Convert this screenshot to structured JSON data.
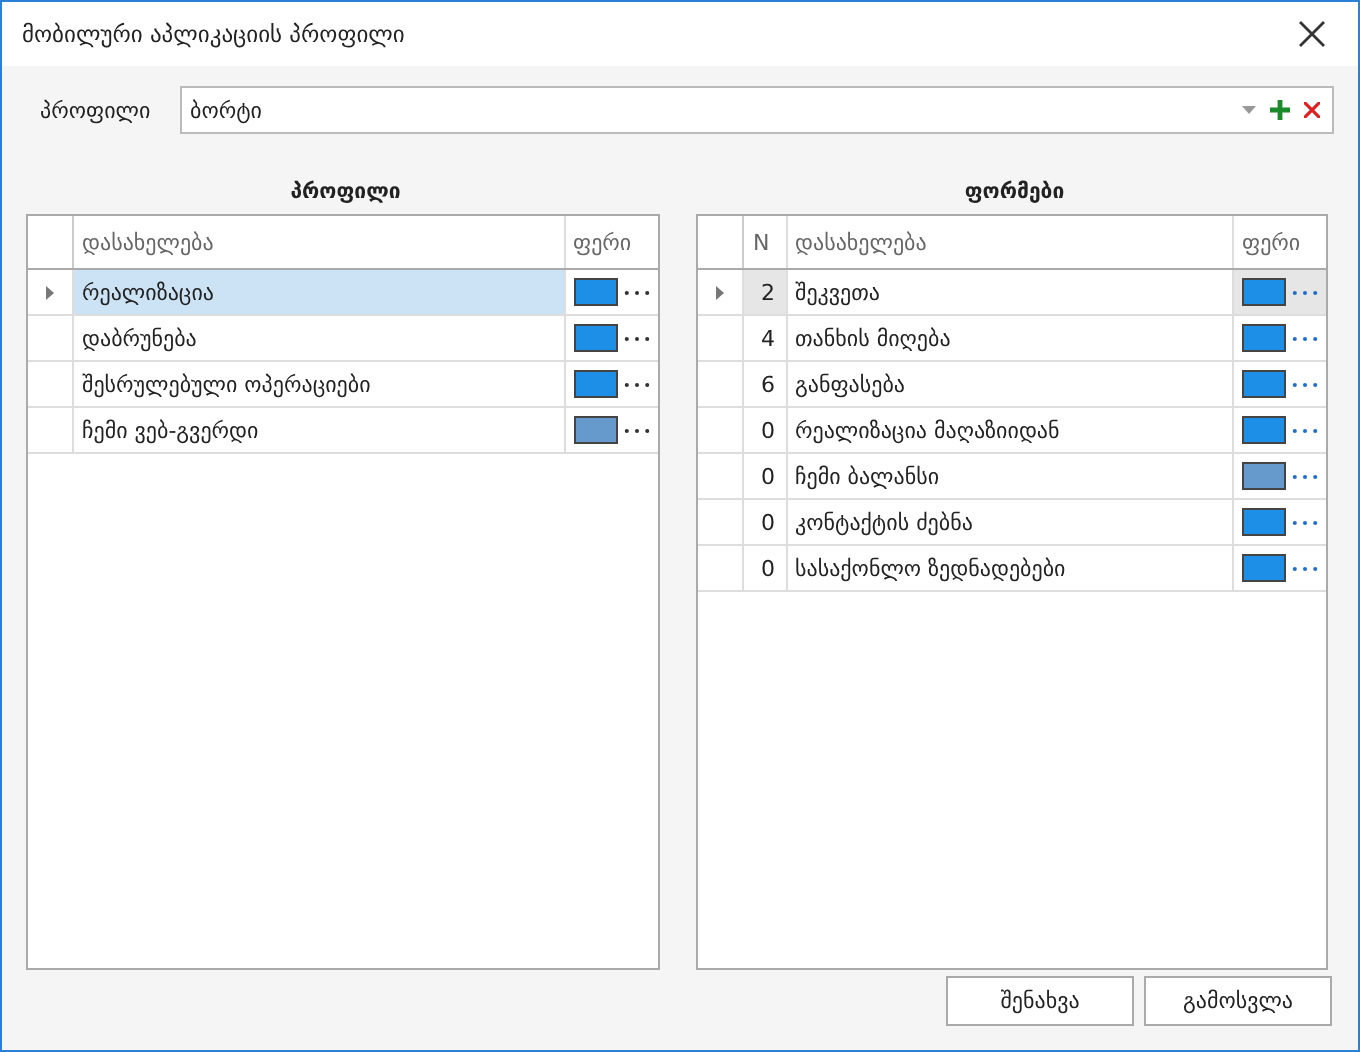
{
  "window": {
    "title": "მობილური აპლიკაციის პროფილი"
  },
  "profile": {
    "label": "პროფილი",
    "value": "ბორტი"
  },
  "left": {
    "title": "პროფილი",
    "columns": [
      "დასახელება",
      "ფერი"
    ],
    "rows": [
      {
        "name": "რეალიზაცია",
        "color": "#1e8fe6",
        "selected": true
      },
      {
        "name": "დაბრუნება",
        "color": "#1e8fe6",
        "selected": false
      },
      {
        "name": "შესრულებული ოპერაციები",
        "color": "#1e8fe6",
        "selected": false
      },
      {
        "name": "ჩემი ვებ-გვერდი",
        "color": "#6699cc",
        "selected": false
      }
    ]
  },
  "right": {
    "title": "ფორმები",
    "columns": [
      "N",
      "დასახელება",
      "ფერი"
    ],
    "rows": [
      {
        "n": "2",
        "name": "შეკვეთა",
        "color": "#1e8fe6",
        "selected": true
      },
      {
        "n": "4",
        "name": "თანხის მიღება",
        "color": "#1e8fe6",
        "selected": false
      },
      {
        "n": "6",
        "name": "განფასება",
        "color": "#1e8fe6",
        "selected": false
      },
      {
        "n": "0",
        "name": "რეალიზაცია მაღაზიიდან",
        "color": "#1e8fe6",
        "selected": false
      },
      {
        "n": "0",
        "name": "ჩემი ბალანსი",
        "color": "#6699cc",
        "selected": false
      },
      {
        "n": "0",
        "name": "კონტაქტის ძებნა",
        "color": "#1e8fe6",
        "selected": false
      },
      {
        "n": "0",
        "name": "სასაქონლო ზედნადებები",
        "color": "#1e8fe6",
        "selected": false
      }
    ]
  },
  "buttons": [
    "შენახვა",
    "გამოსვლა"
  ]
}
